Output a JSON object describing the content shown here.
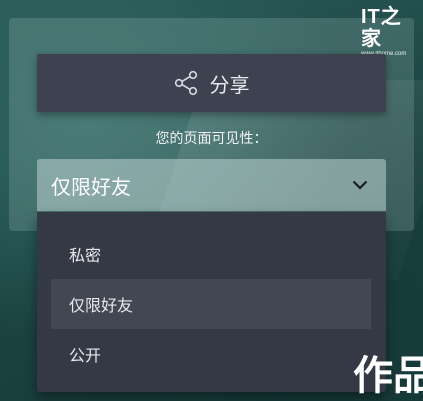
{
  "watermark": {
    "mark": "IT之家",
    "url": "www.ithome.com"
  },
  "share": {
    "label": "分享",
    "icon": "share-icon"
  },
  "visibility": {
    "label": "您的页面可见性：",
    "selected": "仅限好友",
    "options": [
      "私密",
      "仅限好友",
      "公开"
    ]
  },
  "background_text": "作品",
  "colors": {
    "button_bg": "#3e4250",
    "dropdown_bg": "#353845",
    "selected_option_bg": "#434754",
    "text": "#e6e8ec"
  }
}
